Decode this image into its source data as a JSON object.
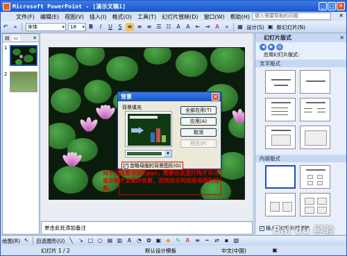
{
  "window": {
    "title": "Microsoft PowerPoint - [演示文稿1]"
  },
  "menu": {
    "items": [
      "文件(F)",
      "编辑(E)",
      "视图(V)",
      "插入(I)",
      "格式(O)",
      "工具(T)",
      "幻灯片放映(D)",
      "窗口(W)",
      "帮助(H)"
    ],
    "help_placeholder": "键入需要帮助的问题"
  },
  "toolbar": {
    "font_name": "宋体",
    "font_size": "18",
    "bold": "B",
    "italic": "I",
    "underline": "U",
    "shadow": "S",
    "design_label": "设计(S)",
    "new_slide_label": "新幻灯片(N)"
  },
  "left_pane": {
    "slide_numbers": [
      "1",
      "2"
    ]
  },
  "notes": {
    "placeholder": "单击此处添加备注"
  },
  "dialog": {
    "title": "背景",
    "fill_label": "背景填充",
    "buttons": {
      "apply_all": "全部应用(T)",
      "apply": "应用(A)",
      "cancel": "取消",
      "preview": "预览(P)"
    },
    "omit_master_label": "忽略母版的背景图形(G)"
  },
  "annotation": {
    "text": "对于已设置母版的ppt，需要在这里打钩才可以显示刚才设置的背景，否则显示的则是母版的背景。",
    "color": "#dd0000"
  },
  "task_pane": {
    "title": "幻灯片版式",
    "apply_label": "应用幻灯片版式:",
    "section_text": "文字版式",
    "section_content": "内容版式",
    "show_on_insert": "插入新幻灯片时放映"
  },
  "draw_toolbar": {
    "draw_label": "绘图(R)",
    "autoshapes_label": "自选图形(U)"
  },
  "status": {
    "slide": "幻灯片 1 / 2",
    "template": "默认设计模板",
    "language": "中文(中国)"
  },
  "watermark": "Bai du 经验"
}
